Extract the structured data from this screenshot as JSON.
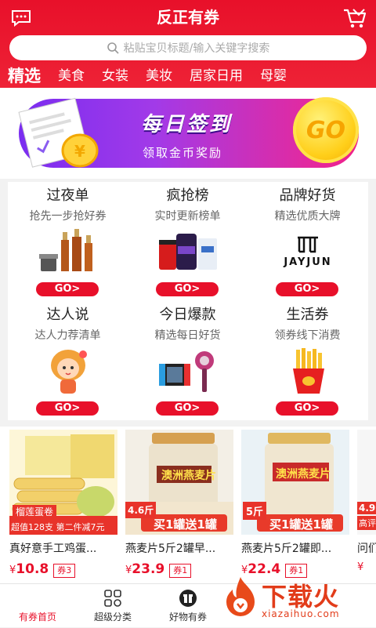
{
  "header": {
    "title": "反正有券",
    "search_placeholder": "粘贴宝贝标题/输入关键字搜索",
    "tabs": [
      "精选",
      "美食",
      "女装",
      "美妆",
      "居家日用",
      "母婴"
    ],
    "accent": "#e8102a"
  },
  "banner": {
    "title": "每日签到",
    "subtitle": "领取金币奖励",
    "go": "GO"
  },
  "grid": {
    "go_label": "GO>",
    "cells": [
      {
        "title": "过夜单",
        "sub": "抢先一步抢好券"
      },
      {
        "title": "疯抢榜",
        "sub": "实时更新榜单"
      },
      {
        "title": "品牌好货",
        "sub": "精选优质大牌",
        "brand": "JAYJUN"
      },
      {
        "title": "达人说",
        "sub": "达人力荐清单"
      },
      {
        "title": "今日爆款",
        "sub": "精选每日好货"
      },
      {
        "title": "生活券",
        "sub": "领券线下消费"
      }
    ]
  },
  "products": [
    {
      "name": "真好意手工鸡蛋...",
      "currency": "¥",
      "price": "10.8",
      "coupon": "券3",
      "img_label": "榴莲蛋卷",
      "img_badge": "超值128支  第二件减7元"
    },
    {
      "name": "燕麦片5斤2罐早...",
      "currency": "¥",
      "price": "23.9",
      "coupon": "券1",
      "img_label": "澳洲燕麦片",
      "img_badge": "买1罐送1罐",
      "img_tag": "4.6斤"
    },
    {
      "name": "燕麦片5斤2罐即...",
      "currency": "¥",
      "price": "22.4",
      "coupon": "券1",
      "img_label": "澳洲燕麦片",
      "img_badge": "买1罐送1罐",
      "img_tag": "5斤"
    },
    {
      "name": "问们",
      "currency": "¥",
      "price": "",
      "coupon": "",
      "img_tag": "4.9",
      "img_badge": "高评"
    }
  ],
  "bottom_nav": [
    {
      "label": "有券首页"
    },
    {
      "label": "超级分类"
    },
    {
      "label": "好物有券"
    }
  ],
  "watermark": {
    "text": "下载火",
    "url": "xiazaihuo.com"
  }
}
